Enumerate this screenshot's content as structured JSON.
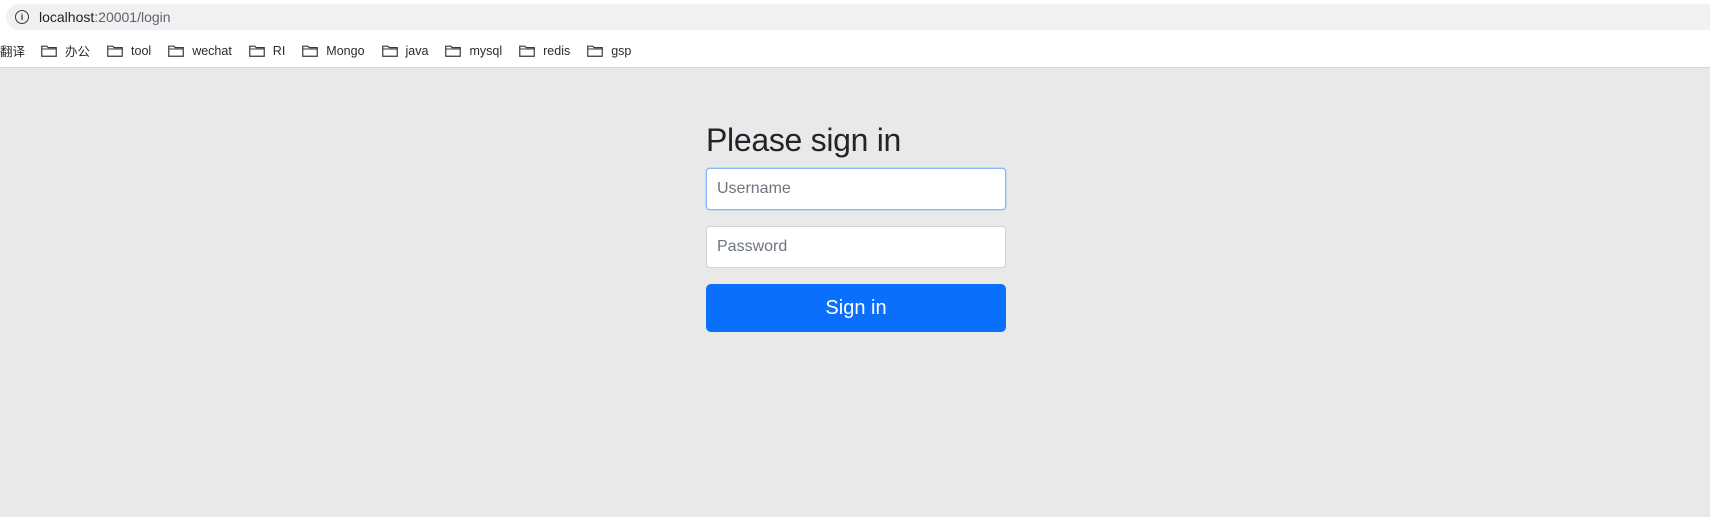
{
  "browser": {
    "url_host": "localhost",
    "url_path": ":20001/login",
    "info_icon": "info-icon"
  },
  "bookmarks": {
    "first_label": "翻译",
    "folders": [
      {
        "label": "办公",
        "icon": "folder-icon"
      },
      {
        "label": "tool",
        "icon": "folder-icon"
      },
      {
        "label": "wechat",
        "icon": "folder-icon"
      },
      {
        "label": "RI",
        "icon": "folder-icon"
      },
      {
        "label": "Mongo",
        "icon": "folder-icon"
      },
      {
        "label": "java",
        "icon": "folder-icon"
      },
      {
        "label": "mysql",
        "icon": "folder-icon"
      },
      {
        "label": "redis",
        "icon": "folder-icon"
      },
      {
        "label": "gsp",
        "icon": "folder-icon"
      }
    ]
  },
  "login": {
    "title": "Please sign in",
    "username": {
      "value": "",
      "placeholder": "Username"
    },
    "password": {
      "value": "",
      "placeholder": "Password"
    },
    "submit_label": "Sign in"
  },
  "colors": {
    "page_bg": "#e9e9ea",
    "button_bg": "#0a6ffd",
    "focus_border": "#86b7fe"
  }
}
